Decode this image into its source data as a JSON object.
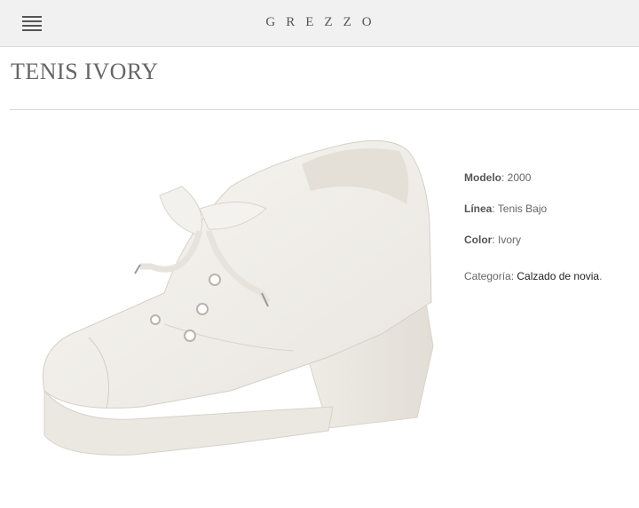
{
  "header": {
    "brand": "GREZZO",
    "menu_icon": "hamburger-menu-icon"
  },
  "product": {
    "title": "TENIS IVORY",
    "image_icon": "ivory-wedge-sneaker-image",
    "modelo_label": "Modelo",
    "modelo_value": "2000",
    "linea_label": "Línea",
    "linea_value": "Tenis Bajo",
    "color_label": "Color",
    "color_value": "Ivory",
    "categoria_label": "Categoría",
    "categoria_link": "Calzado de novia"
  },
  "colors": {
    "topbar_bg": "#f1f1f1",
    "text": "#666666",
    "link": "#222222"
  }
}
